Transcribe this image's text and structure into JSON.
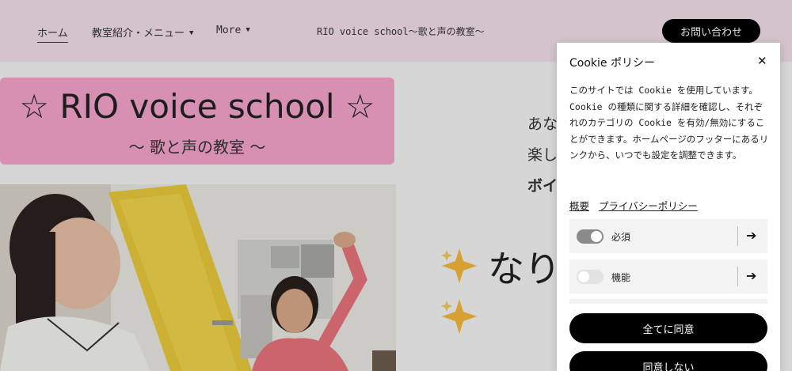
{
  "header": {
    "nav": [
      {
        "label": "ホーム"
      },
      {
        "label": "教室紹介・メニュー"
      },
      {
        "label": "More"
      }
    ],
    "site_title": "RIO voice school～歌と声の教室～",
    "contact_button": "お問い合わせ"
  },
  "hero": {
    "logo_title": "☆ RIO voice school ☆",
    "logo_subtitle": "～ 歌と声の教室 ～",
    "intro_lines": [
      "あな",
      "楽し",
      "ボイ"
    ],
    "heading": "なり",
    "sparkle_icon": "sparkle-emoji"
  },
  "cookie": {
    "title": "Cookie ポリシー",
    "description": "このサイトでは Cookie を使用しています。Cookie の種類に関する詳細を確認し、それぞれのカテゴリの Cookie を有効/無効にすることができます。ホームページのフッターにあるリンクから、いつでも設定を調整できます。",
    "links": {
      "summary": "概要",
      "privacy": "プライバシーポリシー"
    },
    "categories": [
      {
        "label": "必須",
        "enabled": true
      },
      {
        "label": "機能",
        "enabled": false
      }
    ],
    "accept_all": "全てに同意",
    "reject": "同意しない"
  },
  "colors": {
    "header_bg": "#f2dfe8",
    "logo_bg": "#f6a4cb",
    "button_bg": "#000000"
  }
}
